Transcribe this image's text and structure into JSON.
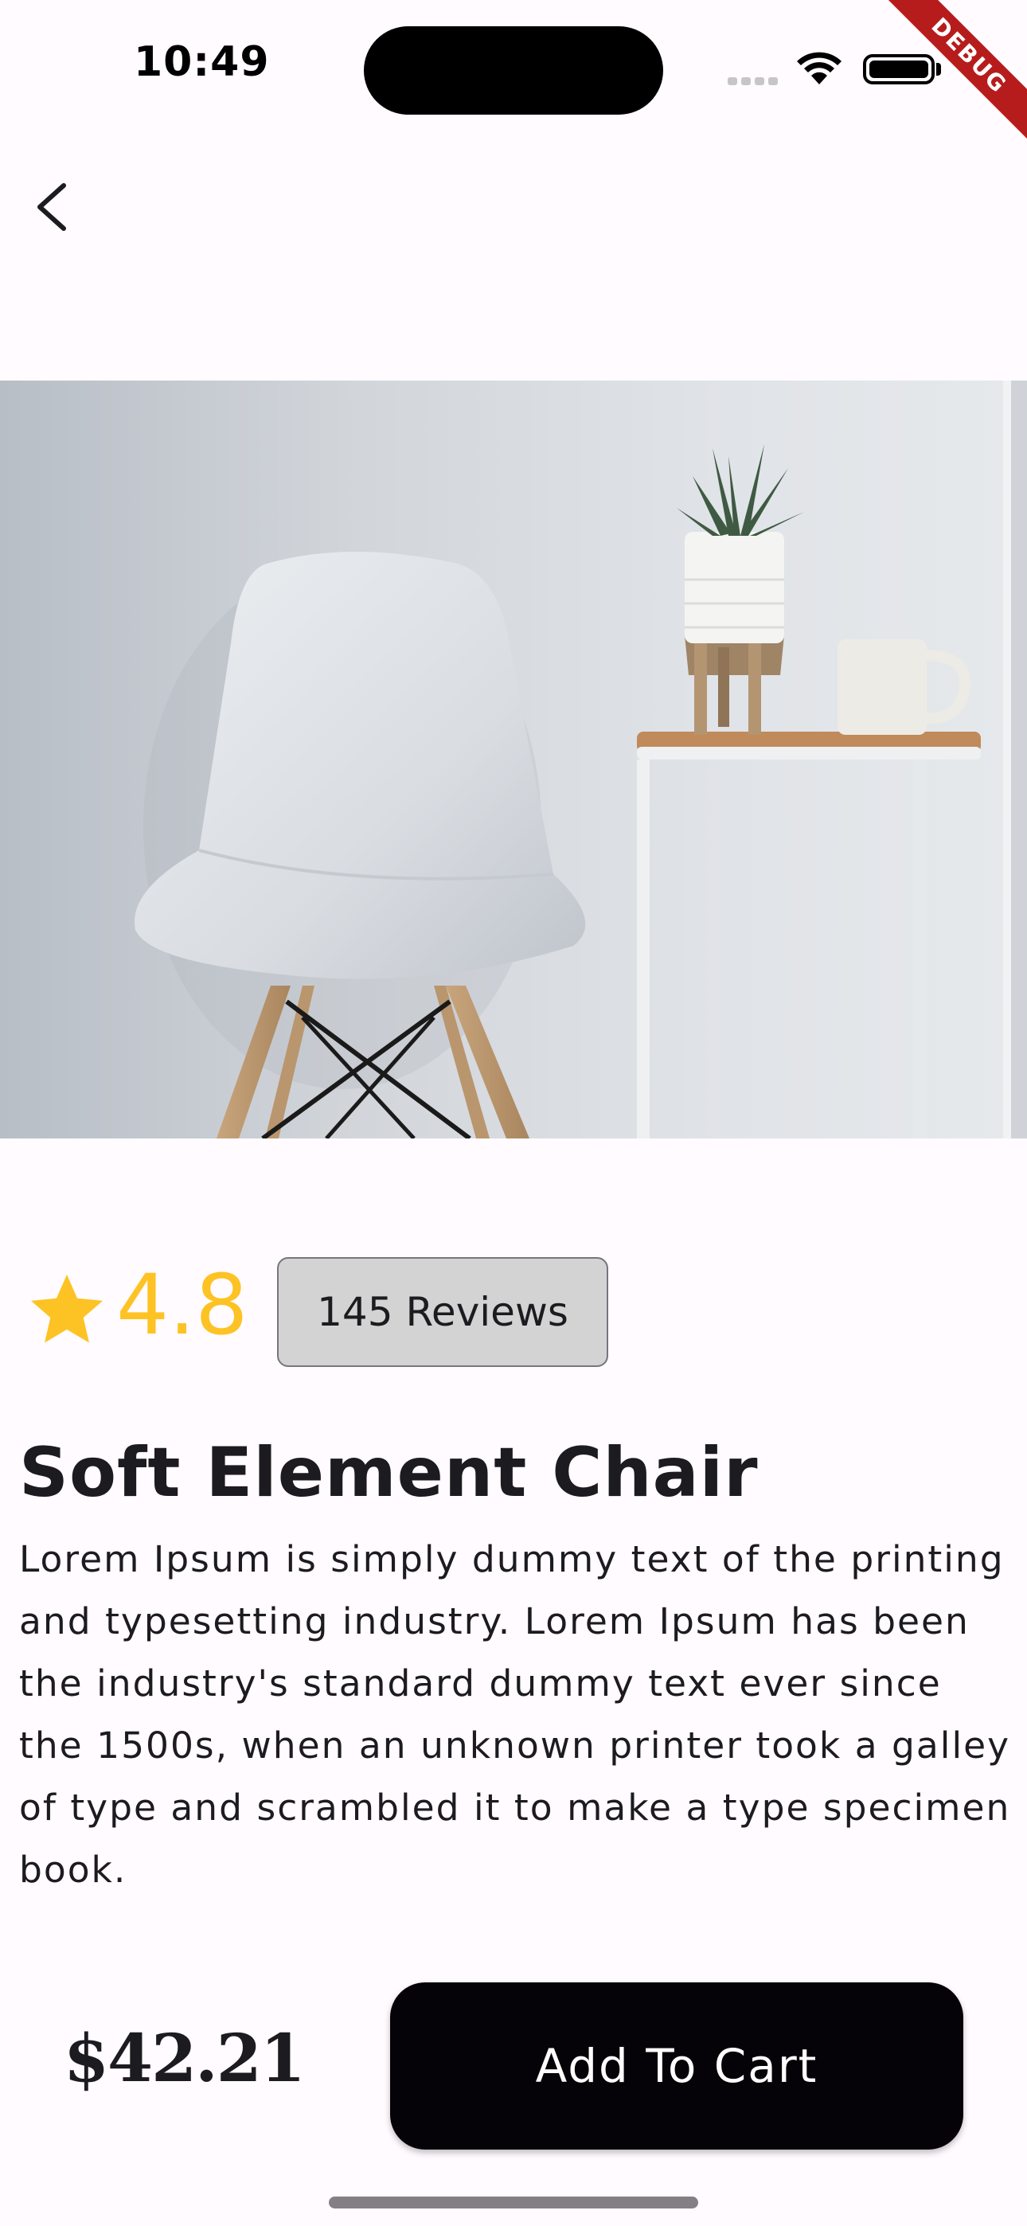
{
  "status_bar": {
    "time": "10:49"
  },
  "debug_banner": "DEBUG",
  "icons": {
    "back": "chevron-left-icon",
    "rating": "star-icon",
    "wifi": "wifi-icon",
    "battery": "battery-icon"
  },
  "product": {
    "rating": "4.8",
    "reviews_label": "145 Reviews",
    "name": "Soft Element Chair",
    "description": "Lorem Ipsum is simply dummy text of the printing and typesetting industry. Lorem Ipsum has been the industry's standard dummy text ever since the 1500s, when an unknown printer took a galley of type and scrambled it to make a type specimen book.",
    "price": "$42.21"
  },
  "actions": {
    "add_to_cart": "Add To Cart"
  },
  "colors": {
    "background": "#fffbfe",
    "rating": "#fdc324",
    "cta": "#050307",
    "reviews_chip": "#d3d3d3",
    "debug": "#b71c1c"
  }
}
